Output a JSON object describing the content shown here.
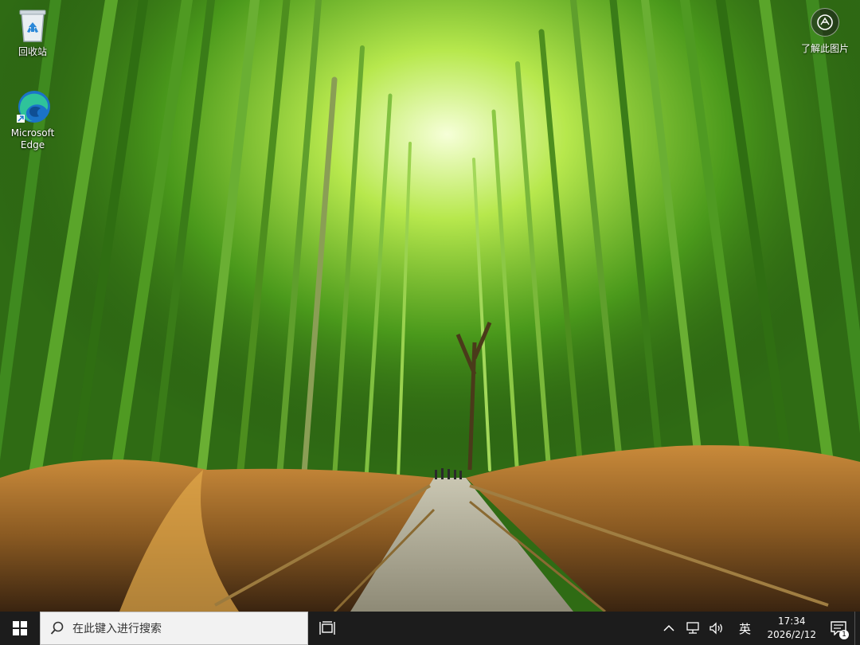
{
  "desktop": {
    "icons": [
      {
        "label": "回收站",
        "icon": "recycle-bin-icon"
      },
      {
        "label": "Microsoft Edge",
        "icon": "edge-icon"
      }
    ],
    "about_picture": {
      "label": "了解此图片",
      "icon": "camera-icon"
    }
  },
  "taskbar": {
    "start_icon": "windows-logo-icon",
    "search": {
      "placeholder": "在此键入进行搜索",
      "icon": "search-icon"
    },
    "task_view_icon": "task-view-icon",
    "tray": {
      "chevron_icon": "chevron-up-icon",
      "network_icon": "network-icon",
      "volume_icon": "volume-icon",
      "ime": "英",
      "time": "17:34",
      "date": "2026/2/12",
      "notifications_icon": "notification-icon",
      "notification_count": "1"
    }
  },
  "colors": {
    "taskbar_bg": "#1c1c1c",
    "search_bg": "#f2f2f2",
    "windows_blue": "#0078d4",
    "edge_teal": "#1fb58a"
  }
}
